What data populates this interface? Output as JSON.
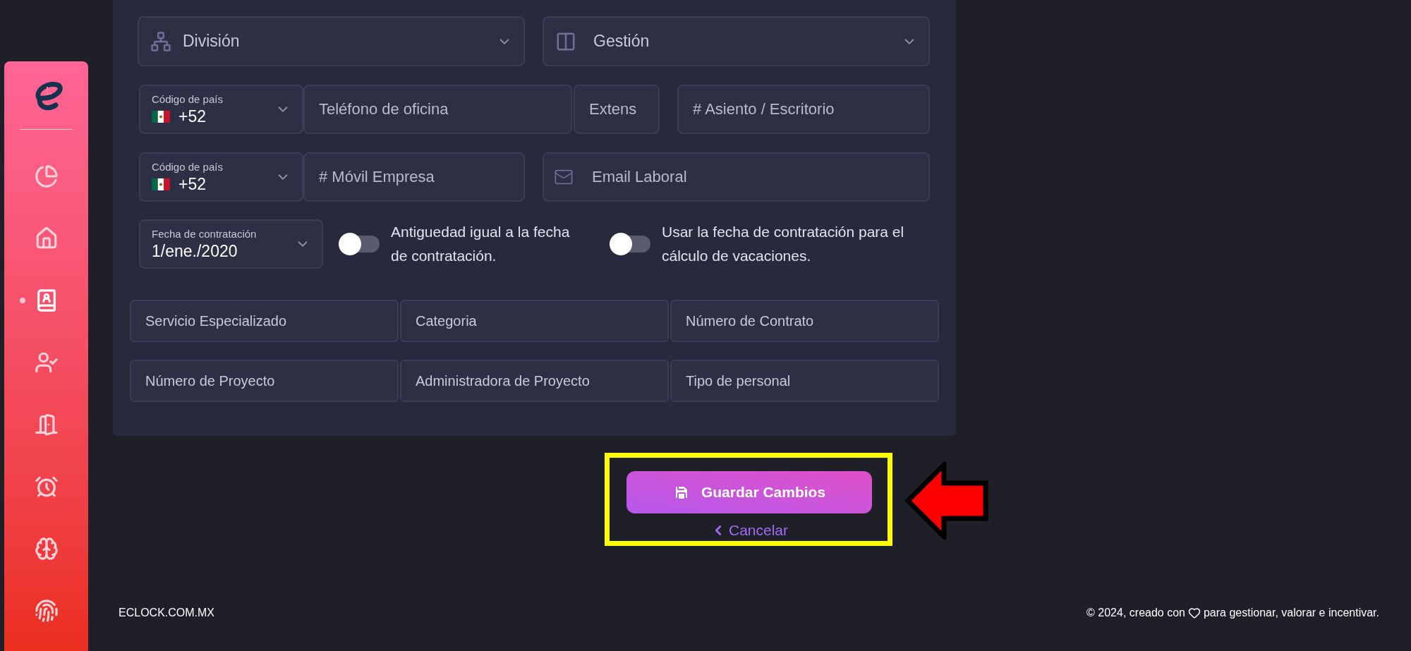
{
  "sidebar": {
    "items": [
      {
        "selected": false
      },
      {
        "selected": false
      },
      {
        "selected": true
      },
      {
        "selected": false
      },
      {
        "selected": false
      },
      {
        "selected": false
      },
      {
        "selected": false
      },
      {
        "selected": false
      }
    ]
  },
  "form": {
    "division": {
      "placeholder": "División"
    },
    "gestion": {
      "placeholder": "Gestión"
    },
    "office_phone": {
      "country_label": "Código de país",
      "country_value": "+52",
      "phone": {
        "placeholder": "Teléfono de oficina"
      },
      "extension": {
        "placeholder": "Extens"
      },
      "seat": {
        "placeholder": "# Asiento / Escritorio"
      }
    },
    "mobile_phone": {
      "country_label": "Código de país",
      "country_value": "+52",
      "phone": {
        "placeholder": "# Móvil Empresa"
      },
      "email": {
        "placeholder": "Email Laboral"
      }
    },
    "hire_date": {
      "label": "Fecha de contratación",
      "value": "1/ene./2020"
    },
    "toggles": [
      {
        "label": "Antiguedad igual a la fecha de contratación.",
        "on": false
      },
      {
        "label": "Usar la fecha de contratación para el cálculo de vacaciones.",
        "on": false
      }
    ],
    "fields": [
      {
        "placeholder": "Servicio Especializado"
      },
      {
        "placeholder": "Categoria"
      },
      {
        "placeholder": "Número de Contrato"
      },
      {
        "placeholder": "Número de Proyecto"
      },
      {
        "placeholder": "Administradora de Proyecto"
      },
      {
        "placeholder": "Tipo de personal"
      }
    ]
  },
  "actions": {
    "save": "Guardar Cambios",
    "cancel": "Cancelar"
  },
  "footer": {
    "site": "ECLOCK.COM.MX",
    "credit_before": "© 2024, creado con",
    "credit_after": "para gestionar, valorar e incentivar."
  }
}
